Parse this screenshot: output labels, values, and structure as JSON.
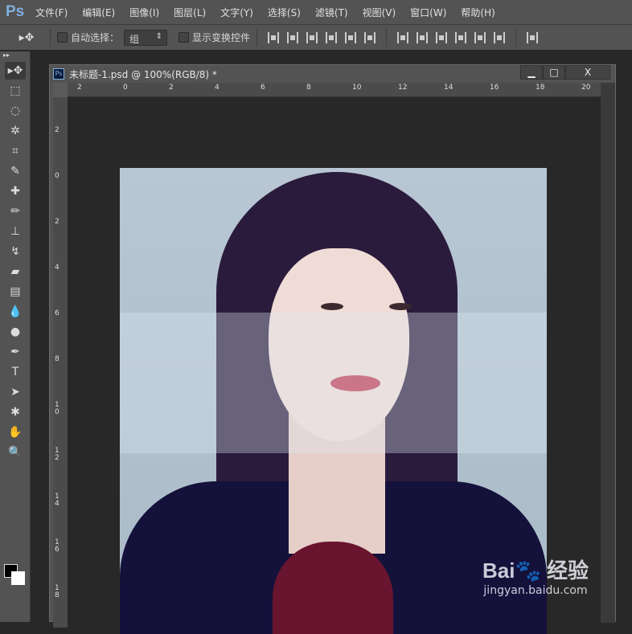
{
  "app": {
    "logo": "Ps"
  },
  "menu": [
    "文件(F)",
    "编辑(E)",
    "图像(I)",
    "图层(L)",
    "文字(Y)",
    "选择(S)",
    "滤镜(T)",
    "视图(V)",
    "窗口(W)",
    "帮助(H)"
  ],
  "options": {
    "auto_select_label": "自动选择：",
    "auto_select_value": "组",
    "show_transform_label": "显示变换控件"
  },
  "tools": [
    "move",
    "marquee",
    "lasso",
    "magic-wand",
    "crop",
    "eyedropper",
    "healing",
    "brush",
    "stamp",
    "history-brush",
    "eraser",
    "gradient",
    "blur",
    "dodge",
    "pen",
    "type",
    "path-select",
    "shape",
    "hand",
    "zoom"
  ],
  "document": {
    "title": "未标题-1.psd @ 100%(RGB/8) *",
    "min": "▁",
    "max": "□",
    "close": "X"
  },
  "ruler": {
    "h": [
      "2",
      "0",
      "2",
      "4",
      "6",
      "8",
      "10",
      "12",
      "14",
      "16",
      "18",
      "20"
    ],
    "v": [
      "2",
      "0",
      "2",
      "4",
      "6",
      "8",
      "1\n0",
      "1\n2",
      "1\n4",
      "1\n6",
      "1\n8"
    ]
  },
  "watermark": {
    "logo": "Bai🐾 经验",
    "url": "jingyan.baidu.com"
  }
}
